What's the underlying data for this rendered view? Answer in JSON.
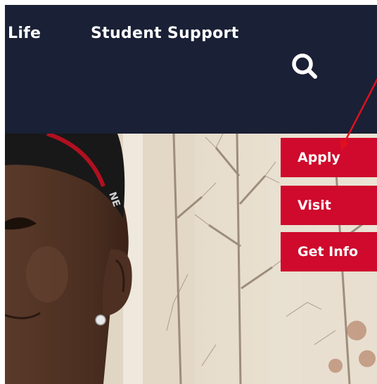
{
  "nav": {
    "items": [
      {
        "label": "Life"
      },
      {
        "label": "Student Support"
      }
    ],
    "search_icon": "search-icon"
  },
  "cta": {
    "apply": "Apply",
    "visit": "Visit",
    "get_info": "Get Info"
  },
  "colors": {
    "navbar": "#1a2035",
    "cta": "#cf0a2c",
    "annotation_arrow": "#e0101f"
  }
}
